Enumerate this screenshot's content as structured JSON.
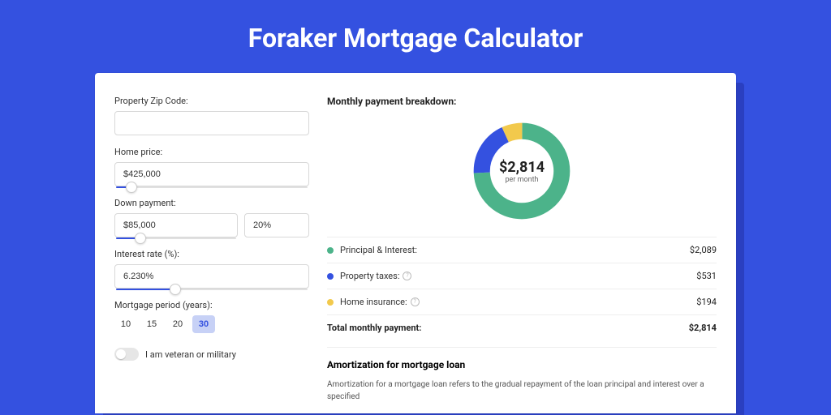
{
  "title": "Foraker Mortgage Calculator",
  "form": {
    "zip_label": "Property Zip Code:",
    "zip_value": "",
    "home_price_label": "Home price:",
    "home_price_value": "$425,000",
    "home_price_slider_pct": 8,
    "down_payment_label": "Down payment:",
    "down_payment_value": "$85,000",
    "down_payment_pct_value": "20%",
    "down_payment_slider_pct": 20,
    "interest_label": "Interest rate (%):",
    "interest_value": "6.230%",
    "interest_slider_pct": 31,
    "period_label": "Mortgage period (years):",
    "periods": [
      "10",
      "15",
      "20",
      "30"
    ],
    "period_selected_index": 3,
    "veteran_label": "I am veteran or military"
  },
  "breakdown": {
    "title": "Monthly payment breakdown:",
    "amount": "$2,814",
    "per_month": "per month",
    "items": [
      {
        "label": "Principal & Interest:",
        "amount": "$2,089",
        "color": "#4cb38a",
        "has_info": false
      },
      {
        "label": "Property taxes:",
        "amount": "$531",
        "color": "#3451e0",
        "has_info": true
      },
      {
        "label": "Home insurance:",
        "amount": "$194",
        "color": "#f2c94c",
        "has_info": true
      }
    ],
    "total_label": "Total monthly payment:",
    "total_amount": "$2,814"
  },
  "chart_data": {
    "type": "pie",
    "title": "Monthly payment breakdown",
    "series": [
      {
        "name": "Principal & Interest",
        "value": 2089,
        "color": "#4cb38a"
      },
      {
        "name": "Property taxes",
        "value": 531,
        "color": "#3451e0"
      },
      {
        "name": "Home insurance",
        "value": 194,
        "color": "#f2c94c"
      }
    ],
    "total": 2814,
    "center_label": "$2,814",
    "center_sublabel": "per month"
  },
  "amortization": {
    "title": "Amortization for mortgage loan",
    "text": "Amortization for a mortgage loan refers to the gradual repayment of the loan principal and interest over a specified"
  }
}
